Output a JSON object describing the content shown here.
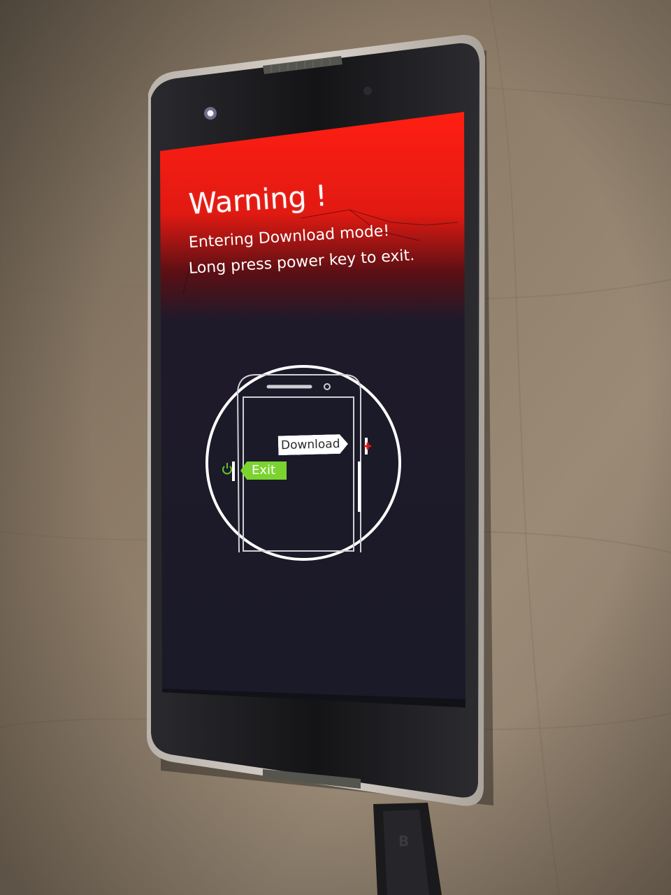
{
  "screen": {
    "title": "Warning !",
    "line1": "Entering Download mode!",
    "line2": "Long press power key to exit."
  },
  "diagram": {
    "download_label": "Download",
    "exit_label": "Exit"
  },
  "colors": {
    "warning_red": "#ff1e12",
    "screen_dark": "#1c1c2a",
    "exit_green": "#7bd32f",
    "plus_red": "#e01818",
    "power_green": "#62c330"
  },
  "icons": [
    "power-icon",
    "plus-icon"
  ]
}
